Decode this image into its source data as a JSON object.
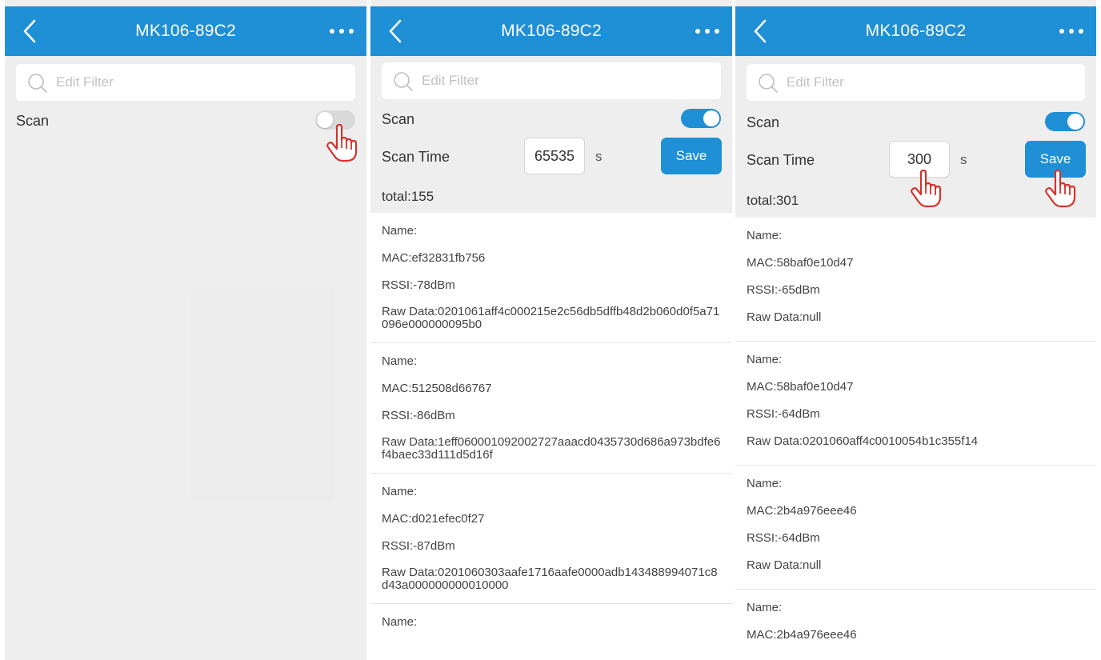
{
  "screens": [
    {
      "title": "MK106-89C2",
      "filter_placeholder": "Edit Filter",
      "scan_label": "Scan",
      "scan_on": false
    },
    {
      "title": "MK106-89C2",
      "filter_placeholder": "Edit Filter",
      "scan_label": "Scan",
      "scan_on": true,
      "scan_time_label": "Scan Time",
      "scan_time_value": "65535",
      "unit": "s",
      "save_label": "Save",
      "total": "total:155",
      "devices": [
        {
          "name": "Name:",
          "mac": "MAC:ef32831fb756",
          "rssi": "RSSI:-78dBm",
          "raw": "Raw Data:0201061aff4c000215e2c56db5dffb48d2b060d0f5a71096e000000095b0"
        },
        {
          "name": "Name:",
          "mac": "MAC:512508d66767",
          "rssi": "RSSI:-86dBm",
          "raw": "Raw Data:1eff060001092002727aaacd0435730d686a973bdfe6f4baec33d111d5d16f"
        },
        {
          "name": "Name:",
          "mac": "MAC:d021efec0f27",
          "rssi": "RSSI:-87dBm",
          "raw": "Raw Data:0201060303aafe1716aafe0000adb143488994071c8d43a000000000010000"
        },
        {
          "name": "Name:"
        }
      ]
    },
    {
      "title": "MK106-89C2",
      "filter_placeholder": "Edit Filter",
      "scan_label": "Scan",
      "scan_on": true,
      "scan_time_label": "Scan Time",
      "scan_time_value": "300",
      "unit": "s",
      "save_label": "Save",
      "total": "total:301",
      "devices": [
        {
          "name": "Name:",
          "mac": "MAC:58baf0e10d47",
          "rssi": "RSSI:-65dBm",
          "raw": "Raw Data:null"
        },
        {
          "name": "Name:",
          "mac": "MAC:58baf0e10d47",
          "rssi": "RSSI:-64dBm",
          "raw": "Raw Data:0201060aff4c0010054b1c355f14"
        },
        {
          "name": "Name:",
          "mac": "MAC:2b4a976eee46",
          "rssi": "RSSI:-64dBm",
          "raw": "Raw Data:null"
        },
        {
          "name": "Name:",
          "mac": "MAC:2b4a976eee46"
        }
      ]
    }
  ],
  "icons": {
    "back": "chevron-left-icon",
    "more": "more-horizontal-icon",
    "search": "search-icon",
    "pointer": "hand-pointer-icon"
  },
  "colors": {
    "brand": "#1f8fd6",
    "background": "#eeeeee",
    "pointer": "#d6322b"
  }
}
